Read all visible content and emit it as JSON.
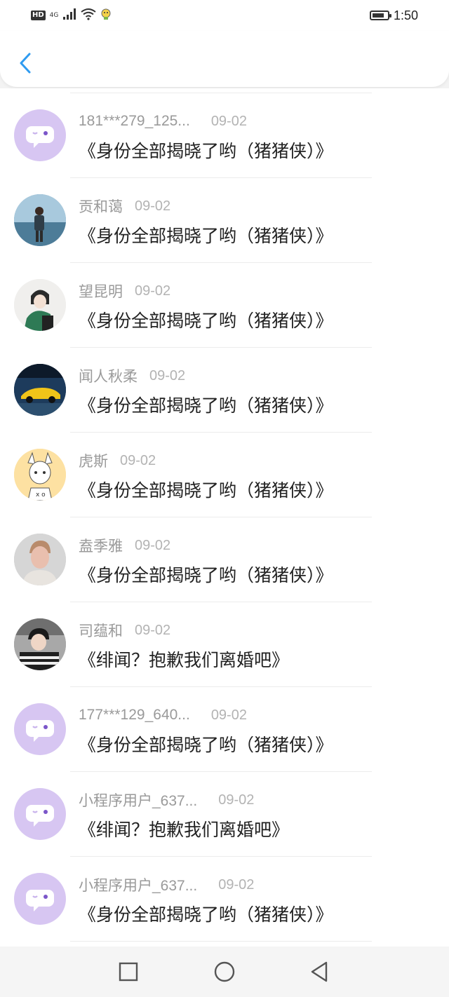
{
  "status_bar": {
    "hd_label": "HD",
    "network_label": "4G",
    "time": "1:50",
    "icons": [
      "signal-icon",
      "wifi-icon",
      "notification-icon",
      "battery-icon"
    ]
  },
  "header": {
    "back_icon": "chevron-left-icon",
    "accent_color": "#2f9bf0"
  },
  "list": {
    "items": [
      {
        "name": "181***279_125...",
        "date": "09-02",
        "title": "《身份全部揭晓了哟（猪猪侠）》",
        "avatar": "default-chat-avatar"
      },
      {
        "name": "贡和蔼",
        "date": "09-02",
        "title": "《身份全部揭晓了哟（猪猪侠）》",
        "avatar": "photo-avatar"
      },
      {
        "name": "望昆明",
        "date": "09-02",
        "title": "《身份全部揭晓了哟（猪猪侠）》",
        "avatar": "photo-avatar"
      },
      {
        "name": "闻人秋柔",
        "date": "09-02",
        "title": "《身份全部揭晓了哟（猪猪侠）》",
        "avatar": "photo-avatar"
      },
      {
        "name": "虎斯",
        "date": "09-02",
        "title": "《身份全部揭晓了哟（猪猪侠）》",
        "avatar": "photo-avatar"
      },
      {
        "name": "盍季雅",
        "date": "09-02",
        "title": "《身份全部揭晓了哟（猪猪侠）》",
        "avatar": "photo-avatar"
      },
      {
        "name": "司蕴和",
        "date": "09-02",
        "title": "《绯闻？抱歉我们离婚吧》",
        "avatar": "photo-avatar"
      },
      {
        "name": "177***129_640...",
        "date": "09-02",
        "title": "《身份全部揭晓了哟（猪猪侠）》",
        "avatar": "default-chat-avatar"
      },
      {
        "name": "小程序用户_637...",
        "date": "09-02",
        "title": "《绯闻？抱歉我们离婚吧》",
        "avatar": "default-chat-avatar"
      },
      {
        "name": "小程序用户_637...",
        "date": "09-02",
        "title": "《身份全部揭晓了哟（猪猪侠）》",
        "avatar": "default-chat-avatar"
      }
    ]
  },
  "nav_bar": {
    "icons": [
      "recent-apps-icon",
      "home-icon",
      "back-triangle-icon"
    ]
  }
}
